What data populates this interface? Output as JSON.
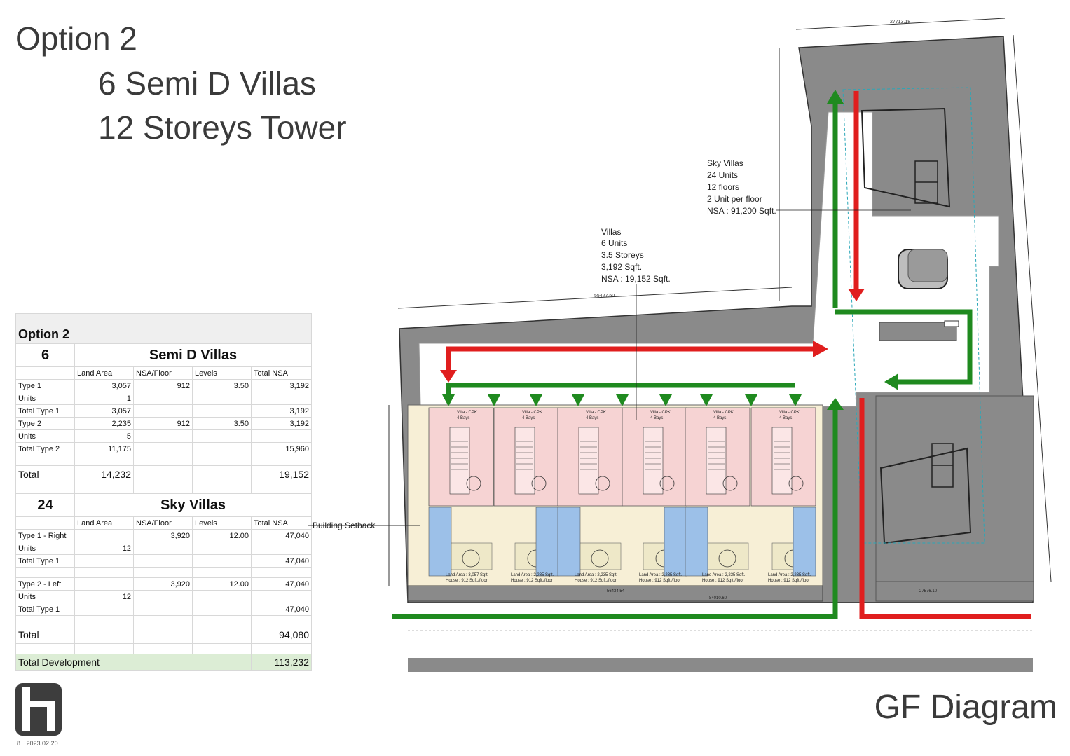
{
  "header": {
    "option": "Option 2",
    "subtitle1": "6 Semi D Villas",
    "subtitle2": "12 Storeys Tower"
  },
  "footer": {
    "page": "8",
    "date": "2023.02.20",
    "diagram_title": "GF Diagram"
  },
  "summary": {
    "title": "Option 2",
    "villas": {
      "count": "6",
      "name": "Semi D Villas",
      "cols": [
        "Land Area",
        "NSA/Floor",
        "Levels",
        "Total NSA"
      ],
      "rows": [
        [
          "Type 1",
          "3,057",
          "912",
          "3.50",
          "3,192"
        ],
        [
          "Units",
          "1",
          "",
          "",
          ""
        ],
        [
          "Total Type 1",
          "3,057",
          "",
          "",
          "3,192"
        ],
        [
          "Type 2",
          "2,235",
          "912",
          "3.50",
          "3,192"
        ],
        [
          "Units",
          "5",
          "",
          "",
          ""
        ],
        [
          "Total Type 2",
          "11,175",
          "",
          "",
          "15,960"
        ]
      ],
      "total_label": "Total",
      "total_land": "14,232",
      "total_nsa": "19,152"
    },
    "sky": {
      "count": "24",
      "name": "Sky Villas",
      "cols": [
        "Land Area",
        "NSA/Floor",
        "Levels",
        "Total NSA"
      ],
      "rows_a": [
        [
          "Type 1 - Right",
          "",
          "3,920",
          "12.00",
          "47,040"
        ],
        [
          "Units",
          "12",
          "",
          "",
          ""
        ],
        [
          "Total Type 1",
          "",
          "",
          "",
          "47,040"
        ]
      ],
      "rows_b": [
        [
          "Type 2 - Left",
          "",
          "3,920",
          "12.00",
          "47,040"
        ],
        [
          "Units",
          "12",
          "",
          "",
          ""
        ],
        [
          "Total Type 1",
          "",
          "",
          "",
          "47,040"
        ]
      ],
      "total_label": "Total",
      "total_nsa": "94,080"
    },
    "development_label": "Total Development",
    "development_total": "113,232"
  },
  "plan": {
    "sky_label": [
      "Sky Villas",
      "24 Units",
      "12 floors",
      "2 Unit per floor",
      "NSA : 91,200 Sqft."
    ],
    "villa_label": [
      "Villas",
      "6 Units",
      "3.5 Storeys",
      "3,192 Sqft.",
      "NSA : 19,152 Sqft."
    ],
    "setback_label": "Building Setback",
    "dims": {
      "top": "27713.18",
      "left_top": "55427.60",
      "bottom1": "56434.54",
      "bottom2": "84010.60",
      "bottom3": "27576.10"
    },
    "unit_tag": "Villa - CPK",
    "unit_tag_sub": "4 Bays",
    "villa_tag": "Villa",
    "lot_type1": [
      "Land Area : 3,057 Sqft.",
      "House : 912 Sqft./floor"
    ],
    "lot_type2": [
      "Land Area : 2,235 Sqft.",
      "House : 912 Sqft./floor"
    ],
    "colors": {
      "gray": "#8a8a8a",
      "red": "#e01e1e",
      "green": "#1f8a1f",
      "pink": "#f6d3d3",
      "blue": "#9cc0e8",
      "cream": "#f7efd6"
    }
  }
}
